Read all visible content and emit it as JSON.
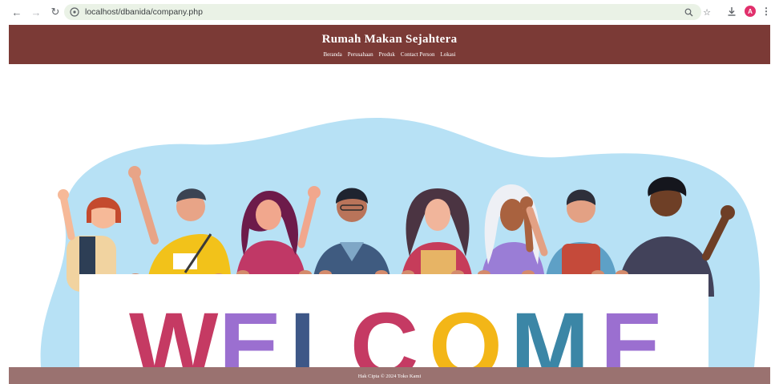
{
  "browser": {
    "url": "localhost/dbanida/company.php",
    "profile_initial": "A"
  },
  "site": {
    "title": "Rumah Makan Sejahtera",
    "nav": [
      "Beranda",
      "Perusahaan",
      "Produk",
      "Contact Person",
      "Lokasi"
    ],
    "footer": "Hak Cipta © 2024 Toko Kami"
  },
  "hero": {
    "welcome_text": "WELCOME",
    "letter_colors": [
      "#c53a63",
      "#9b6fd0",
      "#3d5787",
      "#c53a63",
      "#f3b617",
      "#3b86a6",
      "#9b6fd0"
    ],
    "background_blob": "#b7e1f5"
  }
}
